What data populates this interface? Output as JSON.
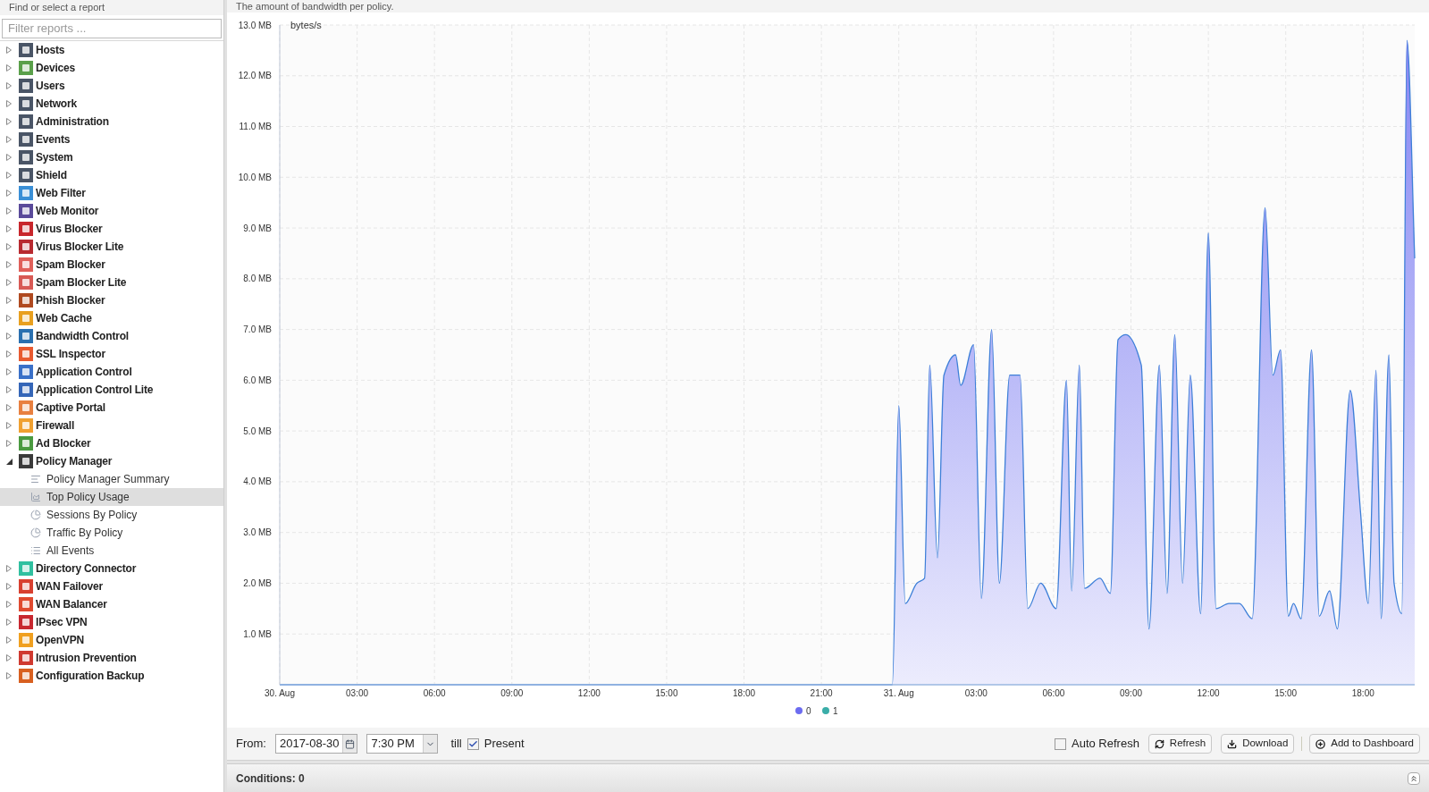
{
  "sidebar": {
    "title": "Find or select a report",
    "filter": {
      "placeholder": "Filter reports ..."
    },
    "items": [
      {
        "label": "Hosts",
        "color": "#4a5566",
        "expanded": false
      },
      {
        "label": "Devices",
        "color": "#5aa04a",
        "expanded": false
      },
      {
        "label": "Users",
        "color": "#4a5566",
        "expanded": false
      },
      {
        "label": "Network",
        "color": "#4a5566",
        "expanded": false
      },
      {
        "label": "Administration",
        "color": "#4a5566",
        "expanded": false
      },
      {
        "label": "Events",
        "color": "#4a5566",
        "expanded": false
      },
      {
        "label": "System",
        "color": "#4a5566",
        "expanded": false
      },
      {
        "label": "Shield",
        "color": "#4a5566",
        "expanded": false
      },
      {
        "label": "Web Filter",
        "color": "#3a8fd6",
        "expanded": false
      },
      {
        "label": "Web Monitor",
        "color": "#5a4a9a",
        "expanded": false
      },
      {
        "label": "Virus Blocker",
        "color": "#c8262c",
        "expanded": false
      },
      {
        "label": "Virus Blocker Lite",
        "color": "#b82a30",
        "expanded": false
      },
      {
        "label": "Spam Blocker",
        "color": "#e0605a",
        "expanded": false
      },
      {
        "label": "Spam Blocker Lite",
        "color": "#d85a55",
        "expanded": false
      },
      {
        "label": "Phish Blocker",
        "color": "#b04a20",
        "expanded": false
      },
      {
        "label": "Web Cache",
        "color": "#e8a020",
        "expanded": false
      },
      {
        "label": "Bandwidth Control",
        "color": "#2a70b0",
        "expanded": false
      },
      {
        "label": "SSL Inspector",
        "color": "#e85a30",
        "expanded": false
      },
      {
        "label": "Application Control",
        "color": "#3a70c8",
        "expanded": false
      },
      {
        "label": "Application Control Lite",
        "color": "#3566b8",
        "expanded": false
      },
      {
        "label": "Captive Portal",
        "color": "#e88040",
        "expanded": false
      },
      {
        "label": "Firewall",
        "color": "#f0a030",
        "expanded": false
      },
      {
        "label": "Ad Blocker",
        "color": "#4a9a40",
        "expanded": false
      },
      {
        "label": "Policy Manager",
        "color": "#3a3a3a",
        "expanded": true,
        "children": [
          {
            "label": "Policy Manager Summary",
            "kind": "text",
            "selected": false
          },
          {
            "label": "Top Policy Usage",
            "kind": "chart",
            "selected": true
          },
          {
            "label": "Sessions By Policy",
            "kind": "pie",
            "selected": false
          },
          {
            "label": "Traffic By Policy",
            "kind": "pie",
            "selected": false
          },
          {
            "label": "All Events",
            "kind": "list",
            "selected": false
          }
        ]
      },
      {
        "label": "Directory Connector",
        "color": "#30c0a0",
        "expanded": false
      },
      {
        "label": "WAN Failover",
        "color": "#d84030",
        "expanded": false
      },
      {
        "label": "WAN Balancer",
        "color": "#e04a30",
        "expanded": false
      },
      {
        "label": "IPsec VPN",
        "color": "#c82830",
        "expanded": false
      },
      {
        "label": "OpenVPN",
        "color": "#f0a020",
        "expanded": false
      },
      {
        "label": "Intrusion Prevention",
        "color": "#d03a30",
        "expanded": false
      },
      {
        "label": "Configuration Backup",
        "color": "#d86020",
        "expanded": false
      }
    ]
  },
  "report": {
    "description": "The amount of bandwidth per policy.",
    "chart_data": {
      "type": "area",
      "grid": true,
      "ylabel": "bytes/s",
      "xlim": [
        "2017-08-30 00:00",
        "2017-08-31 20:00"
      ],
      "ylim": [
        0,
        13
      ],
      "xticks": [
        {
          "value": "2017-08-30 00:00",
          "label": "30. Aug"
        },
        {
          "value": "2017-08-30 03:00",
          "label": "03:00"
        },
        {
          "value": "2017-08-30 06:00",
          "label": "06:00"
        },
        {
          "value": "2017-08-30 09:00",
          "label": "09:00"
        },
        {
          "value": "2017-08-30 12:00",
          "label": "12:00"
        },
        {
          "value": "2017-08-30 15:00",
          "label": "15:00"
        },
        {
          "value": "2017-08-30 18:00",
          "label": "18:00"
        },
        {
          "value": "2017-08-30 21:00",
          "label": "21:00"
        },
        {
          "value": "2017-08-31 00:00",
          "label": "31. Aug"
        },
        {
          "value": "2017-08-31 03:00",
          "label": "03:00"
        },
        {
          "value": "2017-08-31 06:00",
          "label": "06:00"
        },
        {
          "value": "2017-08-31 09:00",
          "label": "09:00"
        },
        {
          "value": "2017-08-31 12:00",
          "label": "12:00"
        },
        {
          "value": "2017-08-31 15:00",
          "label": "15:00"
        },
        {
          "value": "2017-08-31 18:00",
          "label": "18:00"
        }
      ],
      "yticks": [
        {
          "value": 1,
          "label": "1.0 MB"
        },
        {
          "value": 2,
          "label": "2.0 MB"
        },
        {
          "value": 3,
          "label": "3.0 MB"
        },
        {
          "value": 4,
          "label": "4.0 MB"
        },
        {
          "value": 5,
          "label": "5.0 MB"
        },
        {
          "value": 6,
          "label": "6.0 MB"
        },
        {
          "value": 7,
          "label": "7.0 MB"
        },
        {
          "value": 8,
          "label": "8.0 MB"
        },
        {
          "value": 9,
          "label": "9.0 MB"
        },
        {
          "value": 10,
          "label": "10.0 MB"
        },
        {
          "value": 11,
          "label": "11.0 MB"
        },
        {
          "value": 12,
          "label": "12.0 MB"
        },
        {
          "value": 13,
          "label": "13.0 MB"
        }
      ],
      "x": [
        "2017-08-30 00:00",
        "2017-08-30 23:45",
        "2017-08-31 00:00",
        "2017-08-31 00:15",
        "2017-08-31 00:42",
        "2017-08-31 01:00",
        "2017-08-31 01:12",
        "2017-08-31 01:30",
        "2017-08-31 01:45",
        "2017-08-31 02:12",
        "2017-08-31 02:24",
        "2017-08-31 02:54",
        "2017-08-31 03:12",
        "2017-08-31 03:36",
        "2017-08-31 03:54",
        "2017-08-31 04:18",
        "2017-08-31 04:42",
        "2017-08-31 05:00",
        "2017-08-31 05:30",
        "2017-08-31 06:06",
        "2017-08-31 06:30",
        "2017-08-31 06:42",
        "2017-08-31 07:00",
        "2017-08-31 07:12",
        "2017-08-31 07:48",
        "2017-08-31 08:12",
        "2017-08-31 08:30",
        "2017-08-31 08:48",
        "2017-08-31 09:24",
        "2017-08-31 09:42",
        "2017-08-31 10:06",
        "2017-08-31 10:24",
        "2017-08-31 10:42",
        "2017-08-31 11:00",
        "2017-08-31 11:18",
        "2017-08-31 11:42",
        "2017-08-31 12:00",
        "2017-08-31 12:18",
        "2017-08-31 12:48",
        "2017-08-31 13:12",
        "2017-08-31 13:42",
        "2017-08-31 14:12",
        "2017-08-31 14:30",
        "2017-08-31 14:48",
        "2017-08-31 15:06",
        "2017-08-31 15:18",
        "2017-08-31 15:36",
        "2017-08-31 16:00",
        "2017-08-31 16:18",
        "2017-08-31 16:42",
        "2017-08-31 17:00",
        "2017-08-31 17:30",
        "2017-08-31 17:54",
        "2017-08-31 18:12",
        "2017-08-31 18:30",
        "2017-08-31 18:42",
        "2017-08-31 19:00",
        "2017-08-31 19:12",
        "2017-08-31 19:30",
        "2017-08-31 19:42",
        "2017-08-31 20:00"
      ],
      "series": [
        {
          "name": "0",
          "color": "#6c6cf0",
          "values": [
            0,
            0,
            5.5,
            1.6,
            2.0,
            2.1,
            6.3,
            2.5,
            6.1,
            6.5,
            5.9,
            6.7,
            1.7,
            7.0,
            2.0,
            6.1,
            6.1,
            1.5,
            2.0,
            1.5,
            6.0,
            1.85,
            6.3,
            1.9,
            2.1,
            1.8,
            6.8,
            6.9,
            6.3,
            1.1,
            6.3,
            1.8,
            6.9,
            2.0,
            6.1,
            1.4,
            8.9,
            1.5,
            1.6,
            1.6,
            1.3,
            9.4,
            6.1,
            6.6,
            1.35,
            1.6,
            1.3,
            6.6,
            1.35,
            1.85,
            1.1,
            5.8,
            3.4,
            1.6,
            6.2,
            1.3,
            6.5,
            2.0,
            1.4,
            12.7,
            8.4
          ]
        },
        {
          "name": "1",
          "color": "#3aada8",
          "values": [
            null,
            null,
            null,
            null,
            null,
            null,
            null,
            null,
            null,
            null,
            null,
            null,
            null,
            null,
            null,
            null,
            null,
            null,
            null,
            null,
            null,
            null,
            null,
            null,
            null,
            null,
            null,
            null,
            null,
            null,
            null,
            null,
            null,
            null,
            null,
            null,
            null,
            null,
            null,
            null,
            null,
            null,
            null,
            null,
            null,
            null,
            null,
            null,
            null,
            null,
            null,
            null,
            null,
            null,
            null,
            null,
            null,
            null,
            null,
            null,
            null
          ]
        }
      ]
    }
  },
  "toolbar": {
    "from_label": "From:",
    "date": "2017-08-30",
    "time": "7:30 PM",
    "till_label": "till",
    "present": {
      "label": "Present",
      "checked": true
    },
    "auto_refresh": {
      "label": "Auto Refresh",
      "checked": false
    },
    "refresh": "Refresh",
    "download": "Download",
    "add_to_dashboard": "Add to Dashboard"
  },
  "conditions": {
    "label": "Conditions: 0"
  }
}
